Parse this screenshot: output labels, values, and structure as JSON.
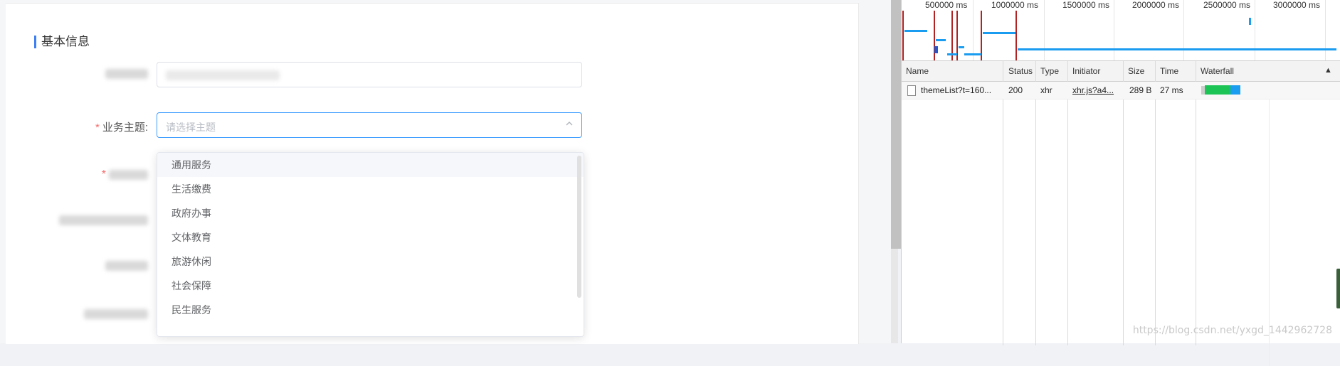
{
  "form": {
    "section_title": "基本信息",
    "rows": [
      {
        "label_visible": "",
        "required": false,
        "placeholder": ""
      },
      {
        "label_visible": "业务主题:",
        "required": true,
        "placeholder": "请选择主题"
      },
      {
        "label_visible": "",
        "required": true
      },
      {
        "label_visible": "",
        "required": false
      },
      {
        "label_visible": "",
        "required": false
      },
      {
        "label_visible": "",
        "required": false
      }
    ],
    "theme_options": [
      "通用服务",
      "生活缴费",
      "政府办事",
      "文体教育",
      "旅游休闲",
      "社会保障",
      "民生服务"
    ]
  },
  "devtools": {
    "timeline_ticks": [
      "500000 ms",
      "1000000 ms",
      "1500000 ms",
      "2000000 ms",
      "2500000 ms",
      "3000000 ms"
    ],
    "columns": [
      "Name",
      "Status",
      "Type",
      "Initiator",
      "Size",
      "Time",
      "Waterfall"
    ],
    "request": {
      "name": "themeList?t=160...",
      "status": "200",
      "type": "xhr",
      "initiator": "xhr.js?a4...",
      "size": "289 B",
      "time": "27 ms"
    },
    "sort_indicator": "▲"
  },
  "watermark": "https://blog.csdn.net/yxgd_1442962728",
  "colors": {
    "accent": "#409eff",
    "required": "#f56c6c",
    "section_bar": "#3d7ef3",
    "waterfall_green": "#1bc454",
    "waterfall_blue": "#1a9cf0"
  }
}
